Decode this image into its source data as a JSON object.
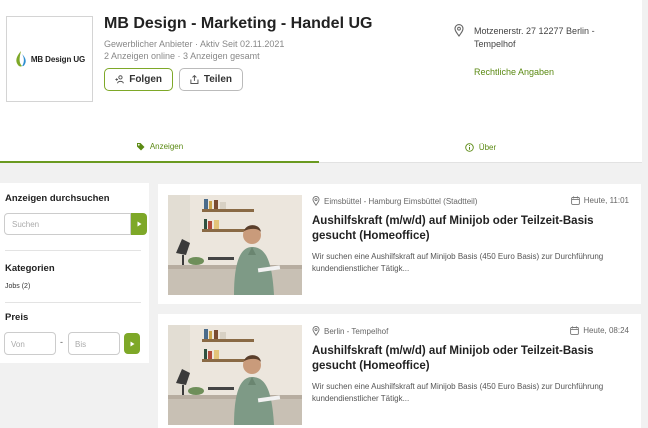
{
  "shop": {
    "logo_text": "MB Design UG",
    "name": "MB Design - Marketing - Handel UG",
    "meta_line1": "Gewerblicher Anbieter · Aktiv Seit 02.11.2021",
    "meta_line2": "2 Anzeigen online · 3 Anzeigen gesamt",
    "follow_label": "Folgen",
    "share_label": "Teilen",
    "address": "Motzenerstr. 27 12277 Berlin - Tempelhof",
    "legal_link": "Rechtliche Angaben"
  },
  "tabs": [
    {
      "label": "Anzeigen",
      "active": true
    },
    {
      "label": "Über",
      "active": false
    }
  ],
  "sidebar": {
    "search_heading": "Anzeigen durchsuchen",
    "search_placeholder": "Suchen",
    "categories_heading": "Kategorien",
    "category_item": "Jobs (2)",
    "price_heading": "Preis",
    "price_from_placeholder": "Von",
    "price_separator": "-",
    "price_to_placeholder": "Bis"
  },
  "listings": [
    {
      "location": "Eimsbüttel - Hamburg Eimsbüttel (Stadtteil)",
      "date": "Heute, 11:01",
      "title": "Aushilfskraft (m/w/d) auf Minijob oder Teilzeit-Basis gesucht (Homeoffice)",
      "description": "Wir suchen eine Aushilfskraft auf Minijob Basis (450 Euro Basis) zur Durchführung kundendienstlicher Tätigk..."
    },
    {
      "location": "Berlin - Tempelhof",
      "date": "Heute, 08:24",
      "title": "Aushilfskraft (m/w/d) auf Minijob oder Teilzeit-Basis gesucht (Homeoffice)",
      "description": "Wir suchen eine Aushilfskraft auf Minijob Basis (450 Euro Basis) zur Durchführung kundendienstlicher Tätigk..."
    }
  ],
  "colors": {
    "accent_green": "#7ea828",
    "link_green": "#5b8a13",
    "page_bg": "#f1f1f1"
  },
  "icons": [
    "leaf-logo-icon",
    "follow-person-icon",
    "share-icon",
    "location-pin-icon",
    "tag-icon",
    "info-icon",
    "arrow-right-icon",
    "calendar-icon"
  ]
}
